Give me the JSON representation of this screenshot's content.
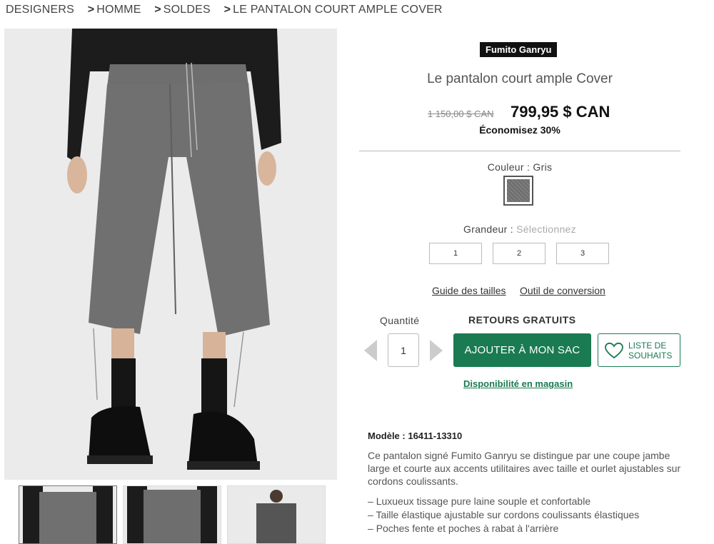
{
  "breadcrumb": {
    "items": [
      "DESIGNERS",
      "HOMME",
      "SOLDES",
      "LE PANTALON COURT AMPLE COVER"
    ],
    "separator": ">"
  },
  "gallery": {
    "main_image": "grey-wide-cropped-pants-photo",
    "thumbnails": [
      "thumb-front-view",
      "thumb-waist-view",
      "thumb-back-view"
    ]
  },
  "product": {
    "brand": "Fumito Ganryu",
    "name": "Le pantalon court ample Cover",
    "old_price": "1 150,00 $ CAN",
    "price": "799,95 $ CAN",
    "savings": "Économisez 30%"
  },
  "color": {
    "label": "Couleur : Gris",
    "swatch_color": "#757575"
  },
  "size": {
    "label": "Grandeur : ",
    "placeholder": "Sélectionnez",
    "options": [
      "1",
      "2",
      "3"
    ]
  },
  "links": {
    "size_guide": "Guide des tailles",
    "conversion": "Outil de conversion"
  },
  "quantity": {
    "label": "Quantité",
    "value": "1"
  },
  "returns": "RETOURS GRATUITS",
  "actions": {
    "add_to_bag": "AJOUTER À MON SAC",
    "wishlist_line1": "LISTE DE",
    "wishlist_line2": "SOUHAITS",
    "store_availability": "Disponibilité en magasin"
  },
  "details": {
    "model": "Modèle : 16411-13310",
    "description": "Ce pantalon signé Fumito Ganryu se distingue par une coupe jambe large et courte aux accents utilitaires avec taille et ourlet ajustables sur cordons coulissants.",
    "features": [
      "Luxueux tissage pure laine souple et confortable",
      "Taille élastique ajustable sur cordons coulissants élastiques",
      "Poches fente et poches à rabat à l'arrière"
    ]
  },
  "colors": {
    "accent": "#1a7a52",
    "badge_bg": "#111111"
  }
}
